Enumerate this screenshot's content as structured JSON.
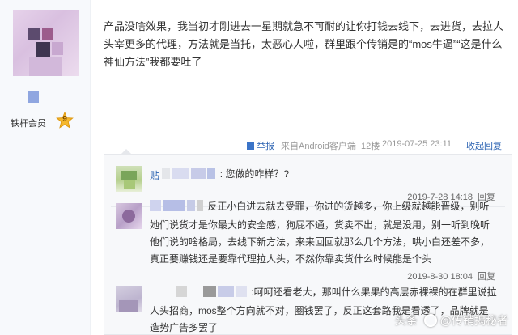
{
  "user": {
    "rank_label": "铁杆会员",
    "level": "9"
  },
  "post": {
    "text": "产品没啥效果，我当初才刚进去一星期就急不可耐的让你打钱去线下，去进货，去拉人头宰更多的代理，方法就是当托，太恶心人啦，群里跟个传销是的“mos牛逼”“这是什么神仙方法”我都要吐了",
    "report": "举报",
    "client": "来自Android客户端",
    "floor": "12楼",
    "time": "2019-07-25 23:11",
    "collapse": "收起回复"
  },
  "replies": [
    {
      "name_fragment": "贴",
      "text": ": 您做的咋样？?",
      "date": "2019-7-28 14:18",
      "reply_label": "回复"
    },
    {
      "text": "反正小白进去就去受罪，你进的货越多，你上级就越能晋级，别听她们说货才是你最大的安全感，狗屁不通，货卖不出，就是没用，别一听到晚听他们说的啥格局，去线下新方法，来来回回就那么几个方法，哄小白还差不多，真正要赚钱还是要靠代理拉人头，不然你靠卖货什么时候能是个头",
      "date": "2019-8-30 18:04",
      "reply_label": "回复"
    },
    {
      "text": ":呵呵还看老大，那叫什么果果的高层赤裸裸的在群里说拉人头招商，mos整个方向就不对，圈钱罢了，反正这套路我是看透了，品牌就是造势广告多罢了"
    }
  ],
  "watermark": {
    "brand": "头条",
    "account": "@传销揭秘者"
  },
  "colors": {
    "link": "#2d64b3",
    "meta_gray": "#999999",
    "reply_bg": "#f7f8fa",
    "level_badge": "#f5b82e"
  }
}
